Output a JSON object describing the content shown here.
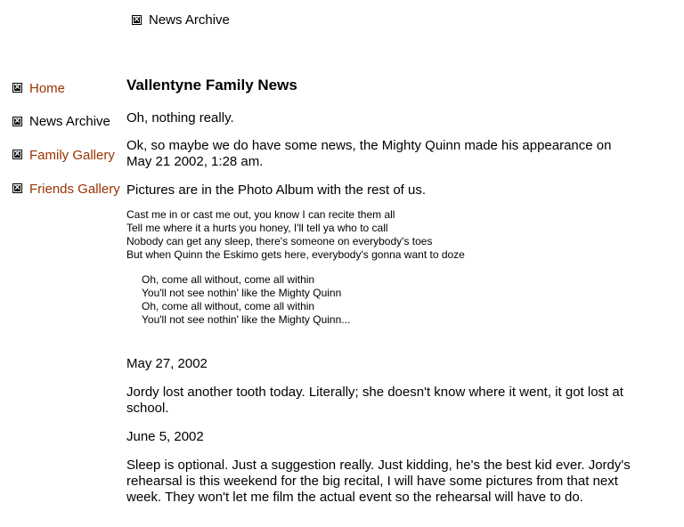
{
  "header": {
    "icon": "broken-image-icon",
    "label": "News Archive"
  },
  "sidebar": {
    "items": [
      {
        "label": "Home",
        "icon": "broken-image-icon",
        "current": false
      },
      {
        "label": "News Archive",
        "icon": "broken-image-icon",
        "current": true
      },
      {
        "label": "Family Gallery",
        "icon": "broken-image-icon",
        "current": false
      },
      {
        "label": "Friends Gallery",
        "icon": "broken-image-icon",
        "current": false
      }
    ]
  },
  "colors": {
    "link": "#993300",
    "text": "#000000"
  },
  "main": {
    "title": "Vallentyne Family News",
    "intro": "Oh, nothing really.",
    "announcement": "Ok, so maybe we do have some news, the Mighty Quinn made his appearance on May 21 2002, 1:28 am.",
    "pictures_note": "Pictures are in the Photo Album with the rest of us.",
    "verse": [
      "Cast me in or cast me out, you know I can recite them all",
      "Tell me where it a hurts you honey, I'll tell ya who to call",
      "Nobody can get any sleep, there's someone on everybody's toes",
      "But when Quinn the Eskimo gets here, everybody's gonna want to doze"
    ],
    "chorus": [
      "Oh, come all without, come all within",
      "You'll not see nothin' like the Mighty Quinn",
      "Oh, come all without, come all within",
      "You'll not see nothin' like the Mighty Quinn..."
    ],
    "entries": [
      {
        "date": "May 27, 2002",
        "text": "Jordy lost another tooth today.  Literally; she doesn't know where it went, it got lost at school."
      },
      {
        "date": "June 5, 2002",
        "text": "Sleep is optional.  Just a suggestion really.  Just kidding, he's the best kid ever.  Jordy's rehearsal is this weekend for the big recital, I will have some pictures from that next week.  They won't let me film the actual event so the rehearsal will have to do."
      }
    ]
  }
}
